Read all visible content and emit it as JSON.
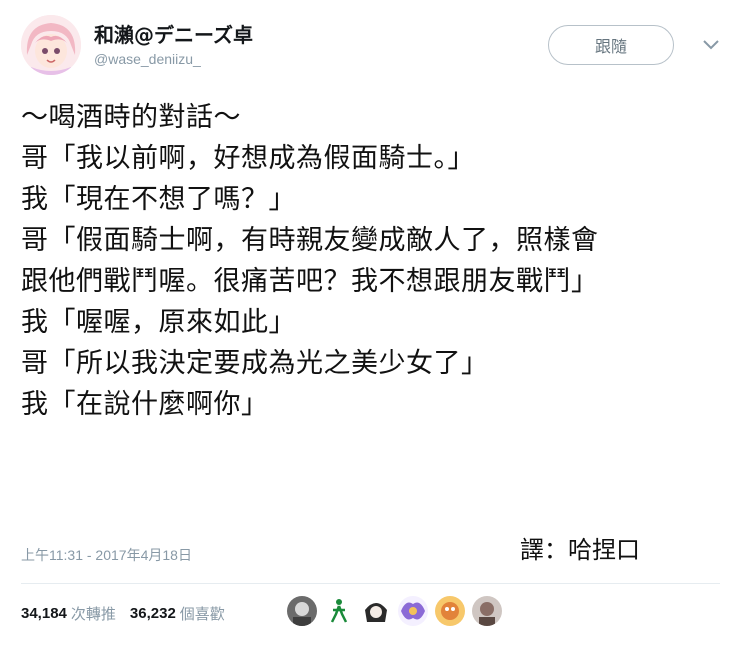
{
  "author": {
    "display_name": "和瀨@デニーズ卓",
    "handle": "@wase_deniizu_"
  },
  "follow_button": {
    "label": "跟隨"
  },
  "tweet": {
    "lines": [
      "～喝酒時的對話～",
      "哥「我以前啊，好想成為假面騎士。」",
      "我「現在不想了嗎？」",
      "哥「假面騎士啊，有時親友變成敵人了，照樣會",
      "跟他們戰鬥喔。很痛苦吧？我不想跟朋友戰鬥」",
      "我「喔喔，原來如此」",
      "哥「所以我決定要成為光之美少女了」",
      "我「在說什麼啊你」"
    ],
    "timestamp": "上午11:31 - 2017年4月18日",
    "credit": "譯：哈捏口"
  },
  "stats": {
    "retweets_count": "34,184",
    "retweets_label": "次轉推",
    "likes_count": "36,232",
    "likes_label": "個喜歡"
  },
  "icons": {
    "avatar": "anime-girl-avatar",
    "chevron": "chevron-down-icon"
  },
  "colors": {
    "text": "#141823",
    "muted": "#8899a6",
    "border": "#b7c1c9"
  }
}
